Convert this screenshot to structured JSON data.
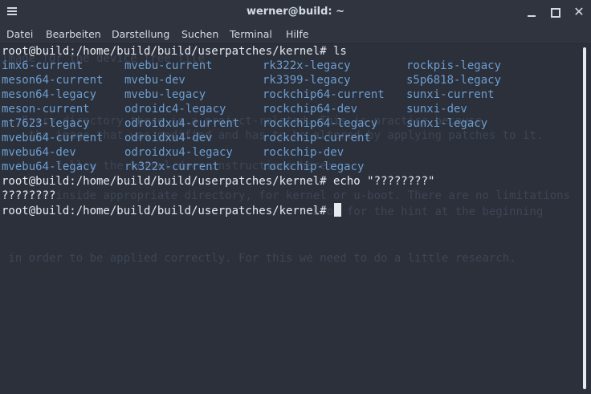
{
  "window": {
    "title": "werner@build: ~",
    "close_glyph": "✕"
  },
  "menubar": {
    "items": [
      "Datei",
      "Bearbeiten",
      "Darstellung",
      "Suchen",
      "Terminal",
      "Hilfe"
    ]
  },
  "terminal": {
    "prompt1": "root@build:/home/build/build/userpatches/kernel# ls",
    "ls_output": [
      [
        "imx6-current",
        "mvebu-current",
        "rk322x-legacy",
        "rockpis-legacy"
      ],
      [
        "meson64-current",
        "mvebu-dev",
        "rk3399-legacy",
        "s5p6818-legacy"
      ],
      [
        "meson64-legacy",
        "mvebu-legacy",
        "rockchip64-current",
        "sunxi-current"
      ],
      [
        "meson-current",
        "odroidc4-legacy",
        "rockchip64-dev",
        "sunxi-dev"
      ],
      [
        "mt7623-legacy",
        "odroidxu4-current",
        "rockchip64-legacy",
        "sunxi-legacy"
      ],
      [
        "mvebu64-current",
        "odroidxu4-dev",
        "rockchip-current",
        ""
      ],
      [
        "mvebu64-dev",
        "odroidxu4-legacy",
        "rockchip-dev",
        ""
      ],
      [
        "mvebu64-legacy",
        "rk322x-current",
        "rockchip-legacy",
        ""
      ]
    ],
    "prompt2": "root@build:/home/build/build/userpatches/kernel# echo \"????????\"",
    "echo_output": "????????",
    "prompt3": "root@build:/home/build/build/userpatches/kernel# "
  },
  "background_text": [
    "Image for the device tree file",
    "   Every directory there is a project-related. This is practice because",
    "    the image that was modified and has to be altered by applying patches to it.",
    "        follow the kernel docs instructions here:",
    "   file inside appropriate directory, for kernel or u-boot. There are no limitations",
    "                                              Look for the hint at the beginning",
    " in order to be applied correctly. For this we need to do a little research."
  ],
  "colors": {
    "terminal_bg": "#2b303b",
    "dir_color": "#6d9ed1",
    "text_color": "#e6e9ef",
    "titlebar_bg": "#2f343f"
  }
}
